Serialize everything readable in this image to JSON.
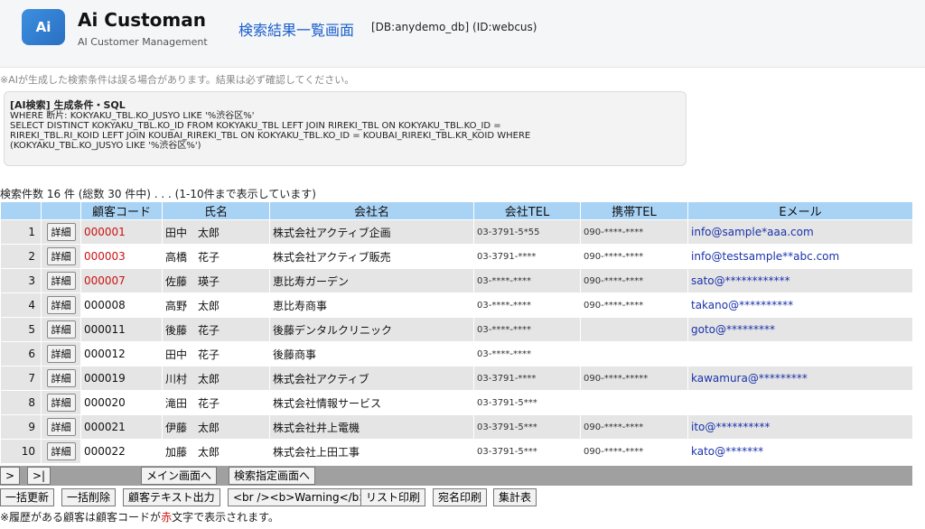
{
  "header": {
    "logo_text": "Ai",
    "app_name": "Ai Customan",
    "app_sub": "AI Customer Management",
    "page_title": "検索結果一覧画面",
    "db_info": "[DB:anydemo_db] (ID:webcus)"
  },
  "ai_warning": "※AIが生成した検索条件は誤る場合があります。結果は必ず確認してください。",
  "sql_box": {
    "title": "[AI検索] 生成条件・SQL",
    "lines": [
      "WHERE 断片: KOKYAKU_TBL.KO_JUSYO LIKE '%渋谷区%'",
      "SELECT DISTINCT KOKYAKU_TBL.KO_ID FROM KOKYAKU_TBL LEFT JOIN RIREKI_TBL ON KOKYAKU_TBL.KO_ID =",
      "RIREKI_TBL.RI_KOID LEFT JOIN KOUBAI_RIREKI_TBL ON KOKYAKU_TBL.KO_ID = KOUBAI_RIREKI_TBL.KR_KOID WHERE",
      "(KOKYAKU_TBL.KO_JUSYO LIKE '%渋谷区%')"
    ]
  },
  "result_count": "検索件数 16 件 (総数 30 件中) . . . (1-10件まで表示しています)",
  "table": {
    "headers": [
      "",
      "",
      "顧客コード",
      "氏名",
      "会社名",
      "会社TEL",
      "携帯TEL",
      "Eメール"
    ],
    "detail_label": "詳細",
    "rows": [
      {
        "no": "1",
        "code": "000001",
        "history": true,
        "name": "田中　太郎",
        "company": "株式会社アクティブ企画",
        "tel": "03-3791-5*55",
        "mobile": "090-****-****",
        "email": "info@sample*aaa.com"
      },
      {
        "no": "2",
        "code": "000003",
        "history": true,
        "name": "高橋　花子",
        "company": "株式会社アクティブ販売",
        "tel": "03-3791-****",
        "mobile": "090-****-****",
        "email": "info@testsample**abc.com"
      },
      {
        "no": "3",
        "code": "000007",
        "history": true,
        "name": "佐藤　瑛子",
        "company": "恵比寿ガーデン",
        "tel": "03-****-****",
        "mobile": "090-****-****",
        "email": "sato@************"
      },
      {
        "no": "4",
        "code": "000008",
        "history": false,
        "name": "高野　太郎",
        "company": "恵比寿商事",
        "tel": "03-****-****",
        "mobile": "090-****-****",
        "email": "takano@**********"
      },
      {
        "no": "5",
        "code": "000011",
        "history": false,
        "name": "後藤　花子",
        "company": "後藤デンタルクリニック",
        "tel": "03-****-****",
        "mobile": "",
        "email": "goto@*********"
      },
      {
        "no": "6",
        "code": "000012",
        "history": false,
        "name": "田中　花子",
        "company": "後藤商事",
        "tel": "03-****-****",
        "mobile": "",
        "email": ""
      },
      {
        "no": "7",
        "code": "000019",
        "history": false,
        "name": "川村　太郎",
        "company": "株式会社アクティブ",
        "tel": "03-3791-****",
        "mobile": "090-****-*****",
        "email": "kawamura@*********"
      },
      {
        "no": "8",
        "code": "000020",
        "history": false,
        "name": "滝田　花子",
        "company": "株式会社情報サービス",
        "tel": "03-3791-5***",
        "mobile": "",
        "email": ""
      },
      {
        "no": "9",
        "code": "000021",
        "history": false,
        "name": "伊藤　太郎",
        "company": "株式会社井上電機",
        "tel": "03-3791-5***",
        "mobile": "090-****-****",
        "email": "ito@**********"
      },
      {
        "no": "10",
        "code": "000022",
        "history": false,
        "name": "加藤　太郎",
        "company": "株式会社上田工事",
        "tel": "03-3791-5***",
        "mobile": "090-****-****",
        "email": "kato@*******"
      }
    ]
  },
  "nav": {
    "next": ">",
    "last": ">|",
    "main_menu": "メイン画面へ",
    "search_spec": "検索指定画面へ"
  },
  "actions": {
    "bulk_update": "一括更新",
    "bulk_delete": "一括削除",
    "text_export": "顧客テキスト出力",
    "warning_btn": "<br /><b>Warning</b>",
    "list_print": "リスト印刷",
    "label_print": "宛名印刷",
    "summary": "集計表"
  },
  "footer": {
    "note_pre": "※履歴がある顧客は顧客コードが",
    "note_red": "赤",
    "note_post": "文字で表示されます。"
  },
  "colors": {
    "header_row": "#a9d3f5",
    "history_code": "#cc1111",
    "email_link": "#1a33aa",
    "title_link": "#1a5fcc"
  }
}
